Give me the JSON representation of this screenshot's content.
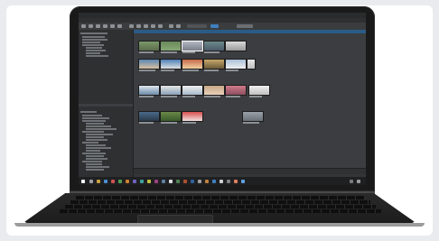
{
  "window": {
    "title": ""
  },
  "menu": [
    "",
    "",
    ""
  ],
  "colors": {
    "accent": "#2a5b86",
    "panel": "#343638",
    "bezel": "#1a1a1a"
  },
  "groups": [
    "",
    "",
    ""
  ],
  "status": {
    "text": ""
  }
}
